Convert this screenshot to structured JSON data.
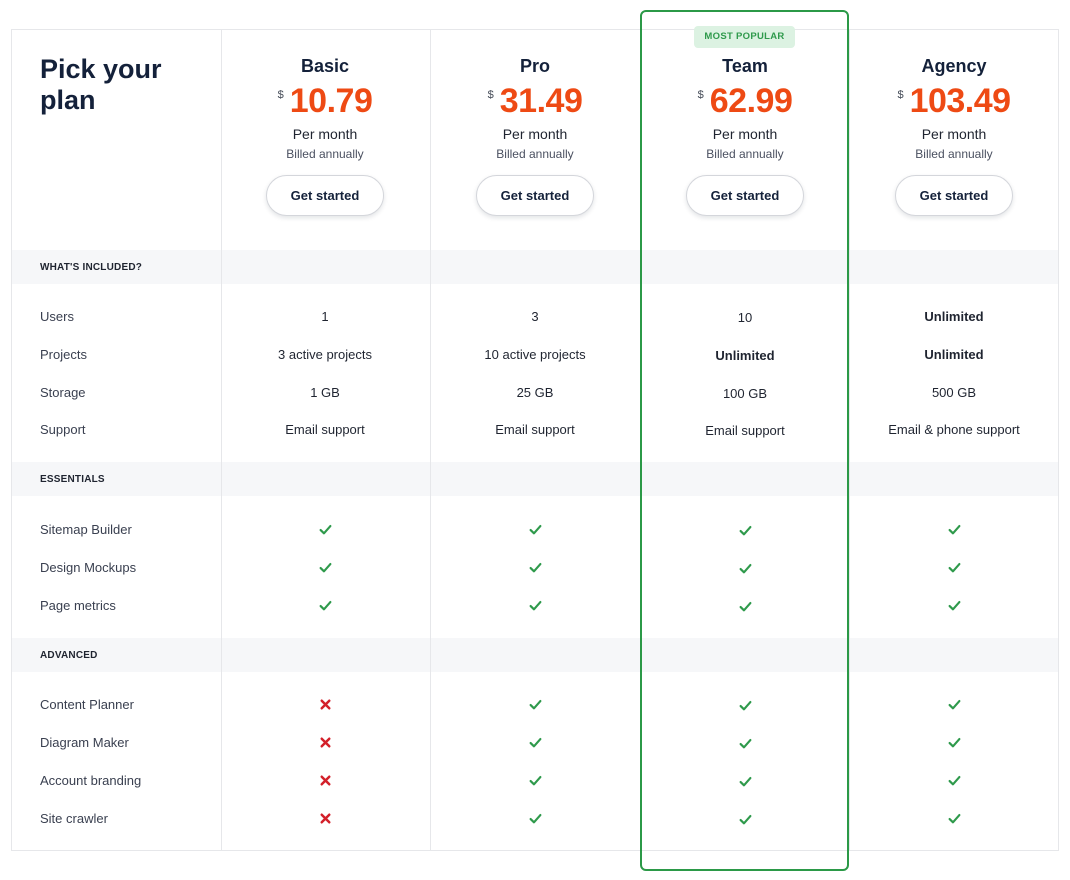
{
  "title": "Pick your plan",
  "badge": "MOST POPULAR",
  "plans": [
    {
      "name": "Basic",
      "currency": "$",
      "price": "10.79",
      "period": "Per month",
      "billing": "Billed annually",
      "cta": "Get started"
    },
    {
      "name": "Pro",
      "currency": "$",
      "price": "31.49",
      "period": "Per month",
      "billing": "Billed annually",
      "cta": "Get started"
    },
    {
      "name": "Team",
      "currency": "$",
      "price": "62.99",
      "period": "Per month",
      "billing": "Billed annually",
      "cta": "Get started"
    },
    {
      "name": "Agency",
      "currency": "$",
      "price": "103.49",
      "period": "Per month",
      "billing": "Billed annually",
      "cta": "Get started"
    }
  ],
  "sections": [
    {
      "title": "WHAT'S INCLUDED?",
      "rows": [
        {
          "label": "Users",
          "values": [
            "1",
            "3",
            "10",
            "Unlimited"
          ]
        },
        {
          "label": "Projects",
          "values": [
            "3 active projects",
            "10 active projects",
            "Unlimited",
            "Unlimited"
          ]
        },
        {
          "label": "Storage",
          "values": [
            "1 GB",
            "25 GB",
            "100 GB",
            "500 GB"
          ]
        },
        {
          "label": "Support",
          "values": [
            "Email support",
            "Email support",
            "Email support",
            "Email & phone support"
          ]
        }
      ]
    },
    {
      "title": "ESSENTIALS",
      "rows": [
        {
          "label": "Sitemap Builder",
          "values": [
            true,
            true,
            true,
            true
          ]
        },
        {
          "label": "Design Mockups",
          "values": [
            true,
            true,
            true,
            true
          ]
        },
        {
          "label": "Page metrics",
          "values": [
            true,
            true,
            true,
            true
          ]
        }
      ]
    },
    {
      "title": "ADVANCED",
      "rows": [
        {
          "label": "Content Planner",
          "values": [
            false,
            true,
            true,
            true
          ]
        },
        {
          "label": "Diagram Maker",
          "values": [
            false,
            true,
            true,
            true
          ]
        },
        {
          "label": "Account branding",
          "values": [
            false,
            true,
            true,
            true
          ]
        },
        {
          "label": "Site crawler",
          "values": [
            false,
            true,
            true,
            true
          ]
        }
      ]
    }
  ],
  "colors": {
    "price": "#ee4a14",
    "check": "#2f9a4c",
    "cross": "#d3202a",
    "popular_border": "#2b9947"
  },
  "icons": {
    "included": "check-icon",
    "excluded": "cross-icon"
  }
}
